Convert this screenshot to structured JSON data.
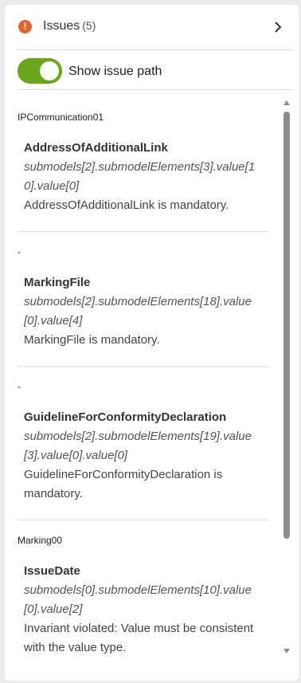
{
  "header": {
    "icon": "warning-icon",
    "title": "Issues",
    "count": "(5)"
  },
  "toggle": {
    "label": "Show issue path",
    "on": true,
    "color": "#6aa51e"
  },
  "groups": [
    {
      "label": "IPCommunication01",
      "issue": {
        "name": "AddressOfAdditionalLink",
        "path": "submodels[2].submodelElements[3].value[10].value[0]",
        "message": "AddressOfAdditionalLink is mandatory."
      }
    },
    {
      "label": "-",
      "issue": {
        "name": "MarkingFile",
        "path": "submodels[2].submodelElements[18].value[0].value[4]",
        "message": "MarkingFile is mandatory."
      }
    },
    {
      "label": "-",
      "issue": {
        "name": "GuidelineForConformityDeclaration",
        "path": "submodels[2].submodelElements[19].value[3].value[0].value[0]",
        "message": "GuidelineForConformityDeclaration is mandatory."
      }
    },
    {
      "label": "Marking00",
      "issue": {
        "name": "IssueDate",
        "path": "submodels[0].submodelElements[10].value[0].value[2]",
        "message": "Invariant violated: Value must be consistent with the value type."
      }
    }
  ]
}
